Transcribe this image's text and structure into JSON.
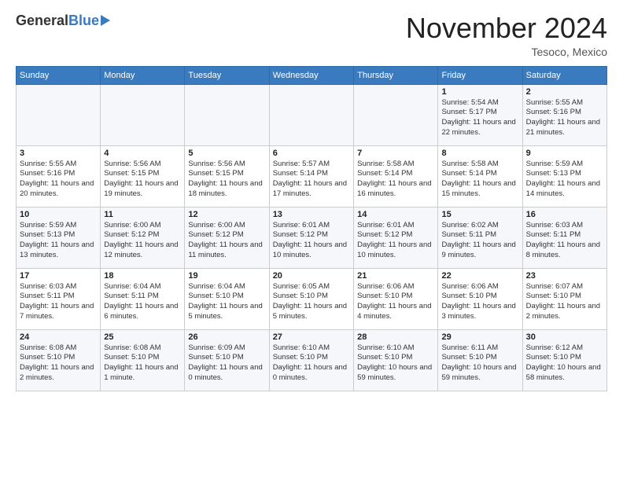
{
  "header": {
    "logo_general": "General",
    "logo_blue": "Blue",
    "month_title": "November 2024",
    "location": "Tesoco, Mexico"
  },
  "days_of_week": [
    "Sunday",
    "Monday",
    "Tuesday",
    "Wednesday",
    "Thursday",
    "Friday",
    "Saturday"
  ],
  "weeks": [
    [
      {
        "day": "",
        "sunrise": "",
        "sunset": "",
        "daylight": ""
      },
      {
        "day": "",
        "sunrise": "",
        "sunset": "",
        "daylight": ""
      },
      {
        "day": "",
        "sunrise": "",
        "sunset": "",
        "daylight": ""
      },
      {
        "day": "",
        "sunrise": "",
        "sunset": "",
        "daylight": ""
      },
      {
        "day": "",
        "sunrise": "",
        "sunset": "",
        "daylight": ""
      },
      {
        "day": "1",
        "sunrise": "Sunrise: 5:54 AM",
        "sunset": "Sunset: 5:17 PM",
        "daylight": "Daylight: 11 hours and 22 minutes."
      },
      {
        "day": "2",
        "sunrise": "Sunrise: 5:55 AM",
        "sunset": "Sunset: 5:16 PM",
        "daylight": "Daylight: 11 hours and 21 minutes."
      }
    ],
    [
      {
        "day": "3",
        "sunrise": "Sunrise: 5:55 AM",
        "sunset": "Sunset: 5:16 PM",
        "daylight": "Daylight: 11 hours and 20 minutes."
      },
      {
        "day": "4",
        "sunrise": "Sunrise: 5:56 AM",
        "sunset": "Sunset: 5:15 PM",
        "daylight": "Daylight: 11 hours and 19 minutes."
      },
      {
        "day": "5",
        "sunrise": "Sunrise: 5:56 AM",
        "sunset": "Sunset: 5:15 PM",
        "daylight": "Daylight: 11 hours and 18 minutes."
      },
      {
        "day": "6",
        "sunrise": "Sunrise: 5:57 AM",
        "sunset": "Sunset: 5:14 PM",
        "daylight": "Daylight: 11 hours and 17 minutes."
      },
      {
        "day": "7",
        "sunrise": "Sunrise: 5:58 AM",
        "sunset": "Sunset: 5:14 PM",
        "daylight": "Daylight: 11 hours and 16 minutes."
      },
      {
        "day": "8",
        "sunrise": "Sunrise: 5:58 AM",
        "sunset": "Sunset: 5:14 PM",
        "daylight": "Daylight: 11 hours and 15 minutes."
      },
      {
        "day": "9",
        "sunrise": "Sunrise: 5:59 AM",
        "sunset": "Sunset: 5:13 PM",
        "daylight": "Daylight: 11 hours and 14 minutes."
      }
    ],
    [
      {
        "day": "10",
        "sunrise": "Sunrise: 5:59 AM",
        "sunset": "Sunset: 5:13 PM",
        "daylight": "Daylight: 11 hours and 13 minutes."
      },
      {
        "day": "11",
        "sunrise": "Sunrise: 6:00 AM",
        "sunset": "Sunset: 5:12 PM",
        "daylight": "Daylight: 11 hours and 12 minutes."
      },
      {
        "day": "12",
        "sunrise": "Sunrise: 6:00 AM",
        "sunset": "Sunset: 5:12 PM",
        "daylight": "Daylight: 11 hours and 11 minutes."
      },
      {
        "day": "13",
        "sunrise": "Sunrise: 6:01 AM",
        "sunset": "Sunset: 5:12 PM",
        "daylight": "Daylight: 11 hours and 10 minutes."
      },
      {
        "day": "14",
        "sunrise": "Sunrise: 6:01 AM",
        "sunset": "Sunset: 5:12 PM",
        "daylight": "Daylight: 11 hours and 10 minutes."
      },
      {
        "day": "15",
        "sunrise": "Sunrise: 6:02 AM",
        "sunset": "Sunset: 5:11 PM",
        "daylight": "Daylight: 11 hours and 9 minutes."
      },
      {
        "day": "16",
        "sunrise": "Sunrise: 6:03 AM",
        "sunset": "Sunset: 5:11 PM",
        "daylight": "Daylight: 11 hours and 8 minutes."
      }
    ],
    [
      {
        "day": "17",
        "sunrise": "Sunrise: 6:03 AM",
        "sunset": "Sunset: 5:11 PM",
        "daylight": "Daylight: 11 hours and 7 minutes."
      },
      {
        "day": "18",
        "sunrise": "Sunrise: 6:04 AM",
        "sunset": "Sunset: 5:11 PM",
        "daylight": "Daylight: 11 hours and 6 minutes."
      },
      {
        "day": "19",
        "sunrise": "Sunrise: 6:04 AM",
        "sunset": "Sunset: 5:10 PM",
        "daylight": "Daylight: 11 hours and 5 minutes."
      },
      {
        "day": "20",
        "sunrise": "Sunrise: 6:05 AM",
        "sunset": "Sunset: 5:10 PM",
        "daylight": "Daylight: 11 hours and 5 minutes."
      },
      {
        "day": "21",
        "sunrise": "Sunrise: 6:06 AM",
        "sunset": "Sunset: 5:10 PM",
        "daylight": "Daylight: 11 hours and 4 minutes."
      },
      {
        "day": "22",
        "sunrise": "Sunrise: 6:06 AM",
        "sunset": "Sunset: 5:10 PM",
        "daylight": "Daylight: 11 hours and 3 minutes."
      },
      {
        "day": "23",
        "sunrise": "Sunrise: 6:07 AM",
        "sunset": "Sunset: 5:10 PM",
        "daylight": "Daylight: 11 hours and 2 minutes."
      }
    ],
    [
      {
        "day": "24",
        "sunrise": "Sunrise: 6:08 AM",
        "sunset": "Sunset: 5:10 PM",
        "daylight": "Daylight: 11 hours and 2 minutes."
      },
      {
        "day": "25",
        "sunrise": "Sunrise: 6:08 AM",
        "sunset": "Sunset: 5:10 PM",
        "daylight": "Daylight: 11 hours and 1 minute."
      },
      {
        "day": "26",
        "sunrise": "Sunrise: 6:09 AM",
        "sunset": "Sunset: 5:10 PM",
        "daylight": "Daylight: 11 hours and 0 minutes."
      },
      {
        "day": "27",
        "sunrise": "Sunrise: 6:10 AM",
        "sunset": "Sunset: 5:10 PM",
        "daylight": "Daylight: 11 hours and 0 minutes."
      },
      {
        "day": "28",
        "sunrise": "Sunrise: 6:10 AM",
        "sunset": "Sunset: 5:10 PM",
        "daylight": "Daylight: 10 hours and 59 minutes."
      },
      {
        "day": "29",
        "sunrise": "Sunrise: 6:11 AM",
        "sunset": "Sunset: 5:10 PM",
        "daylight": "Daylight: 10 hours and 59 minutes."
      },
      {
        "day": "30",
        "sunrise": "Sunrise: 6:12 AM",
        "sunset": "Sunset: 5:10 PM",
        "daylight": "Daylight: 10 hours and 58 minutes."
      }
    ]
  ]
}
